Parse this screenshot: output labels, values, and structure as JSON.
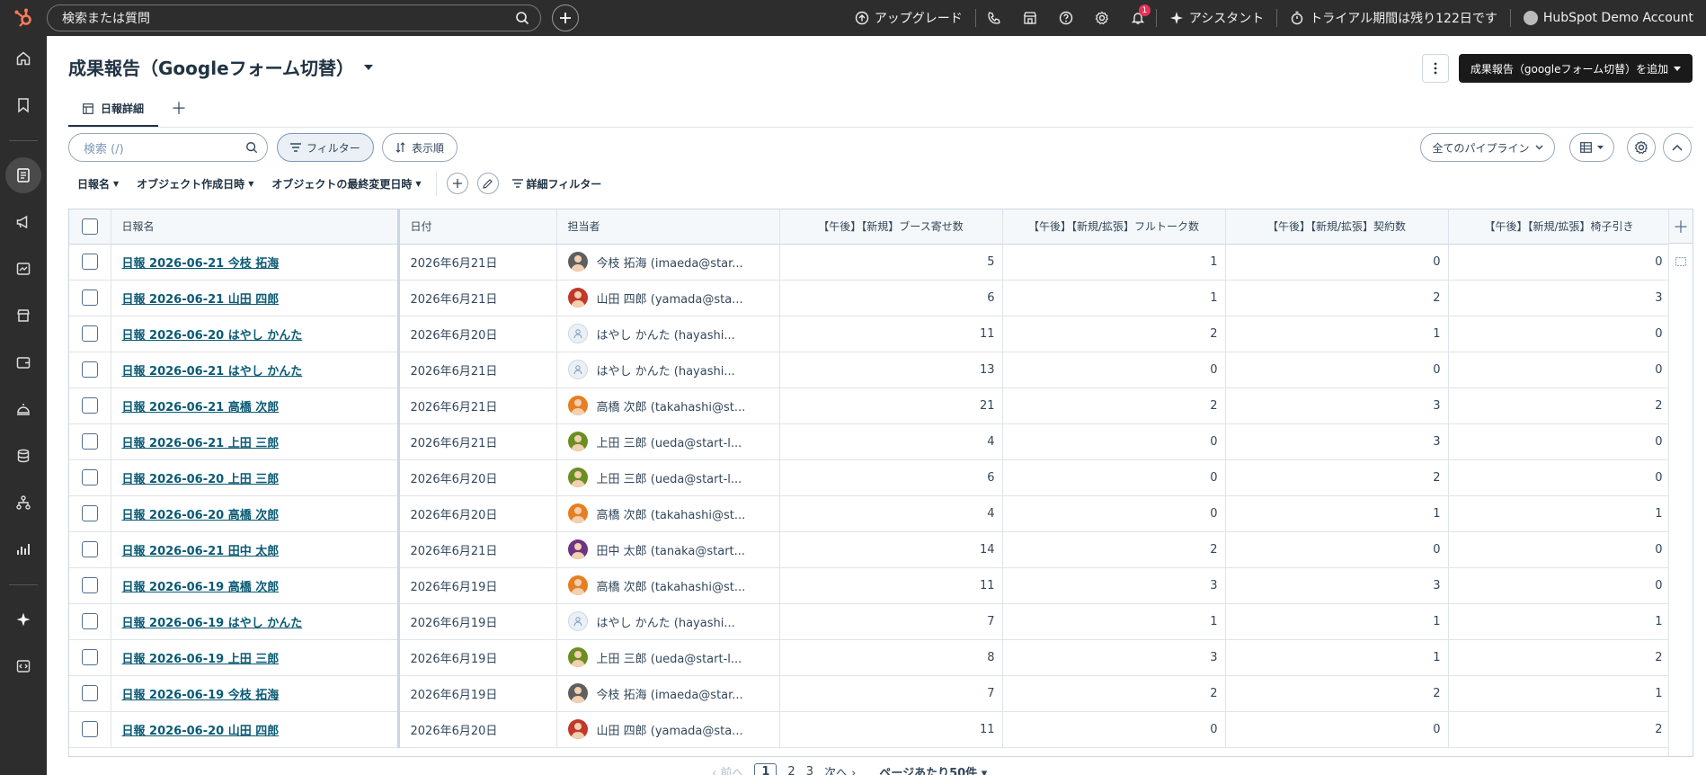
{
  "topbar": {
    "search_placeholder": "検索または質問",
    "upgrade": "アップグレード",
    "notif_count": "1",
    "assistant": "アシスタント",
    "trial": "トライアル期間は残り122日です",
    "account": "HubSpot Demo Account"
  },
  "page": {
    "title": "成果報告（Googleフォーム切替）",
    "add_button": "成果報告（googleフォーム切替）を追加",
    "tab_label": "日報詳細"
  },
  "toolbar": {
    "search_placeholder": "検索 (/)",
    "filter": "フィルター",
    "sort": "表示順",
    "pipeline": "全てのパイプライン"
  },
  "filters": {
    "report_name": "日報名",
    "created": "オブジェクト作成日時",
    "modified": "オブジェクトの最終変更日時",
    "advanced": "詳細フィルター"
  },
  "table": {
    "headers": [
      "日報名",
      "日付",
      "担当者",
      "【午後】【新規】ブース寄せ数",
      "【午後】【新規/拡張】フルトーク数",
      "【午後】【新規/拡張】契約数",
      "【午後】【新規/拡張】椅子引き"
    ],
    "rows": [
      {
        "name": "日報 2026-06-21 今枝 拓海",
        "date": "2026年6月21日",
        "owner": "今枝 拓海 (imaeda@star...",
        "av": "#5f5f5f",
        "c1": "5",
        "c2": "1",
        "c3": "0",
        "c4": "0"
      },
      {
        "name": "日報 2026-06-21 山田 四郎",
        "date": "2026年6月21日",
        "owner": "山田 四郎 (yamada@sta...",
        "av": "#c0392b",
        "c1": "6",
        "c2": "1",
        "c3": "2",
        "c4": "3"
      },
      {
        "name": "日報 2026-06-20 はやし かんた",
        "date": "2026年6月20日",
        "owner": "はやし かんた (hayashi...",
        "av": "",
        "c1": "11",
        "c2": "2",
        "c3": "1",
        "c4": "0"
      },
      {
        "name": "日報 2026-06-21 はやし かんた",
        "date": "2026年6月21日",
        "owner": "はやし かんた (hayashi...",
        "av": "",
        "c1": "13",
        "c2": "0",
        "c3": "0",
        "c4": "0"
      },
      {
        "name": "日報 2026-06-21 高橋 次郎",
        "date": "2026年6月21日",
        "owner": "高橋 次郎 (takahashi@st...",
        "av": "#e67e22",
        "c1": "21",
        "c2": "2",
        "c3": "3",
        "c4": "2"
      },
      {
        "name": "日報 2026-06-21 上田 三郎",
        "date": "2026年6月21日",
        "owner": "上田 三郎 (ueda@start-l...",
        "av": "#6b8e23",
        "c1": "4",
        "c2": "0",
        "c3": "3",
        "c4": "0"
      },
      {
        "name": "日報 2026-06-20 上田 三郎",
        "date": "2026年6月20日",
        "owner": "上田 三郎 (ueda@start-l...",
        "av": "#6b8e23",
        "c1": "6",
        "c2": "0",
        "c3": "2",
        "c4": "0"
      },
      {
        "name": "日報 2026-06-20 高橋 次郎",
        "date": "2026年6月20日",
        "owner": "高橋 次郎 (takahashi@st...",
        "av": "#e67e22",
        "c1": "4",
        "c2": "0",
        "c3": "1",
        "c4": "1"
      },
      {
        "name": "日報 2026-06-21 田中 太郎",
        "date": "2026年6月21日",
        "owner": "田中 太郎 (tanaka@start...",
        "av": "#6c3483",
        "c1": "14",
        "c2": "2",
        "c3": "0",
        "c4": "0"
      },
      {
        "name": "日報 2026-06-19 高橋 次郎",
        "date": "2026年6月19日",
        "owner": "高橋 次郎 (takahashi@st...",
        "av": "#e67e22",
        "c1": "11",
        "c2": "3",
        "c3": "3",
        "c4": "0"
      },
      {
        "name": "日報 2026-06-19 はやし かんた",
        "date": "2026年6月19日",
        "owner": "はやし かんた (hayashi...",
        "av": "",
        "c1": "7",
        "c2": "1",
        "c3": "1",
        "c4": "1"
      },
      {
        "name": "日報 2026-06-19 上田 三郎",
        "date": "2026年6月19日",
        "owner": "上田 三郎 (ueda@start-l...",
        "av": "#6b8e23",
        "c1": "8",
        "c2": "3",
        "c3": "1",
        "c4": "2"
      },
      {
        "name": "日報 2026-06-19 今枝 拓海",
        "date": "2026年6月19日",
        "owner": "今枝 拓海 (imaeda@star...",
        "av": "#5f5f5f",
        "c1": "7",
        "c2": "2",
        "c3": "2",
        "c4": "1"
      },
      {
        "name": "日報 2026-06-20 山田 四郎",
        "date": "2026年6月20日",
        "owner": "山田 四郎 (yamada@sta...",
        "av": "#c0392b",
        "c1": "11",
        "c2": "0",
        "c3": "0",
        "c4": "2"
      }
    ]
  },
  "pager": {
    "prev": "前へ",
    "pages": [
      "1",
      "2",
      "3"
    ],
    "next": "次へ",
    "per_page": "ページあたり50件"
  }
}
